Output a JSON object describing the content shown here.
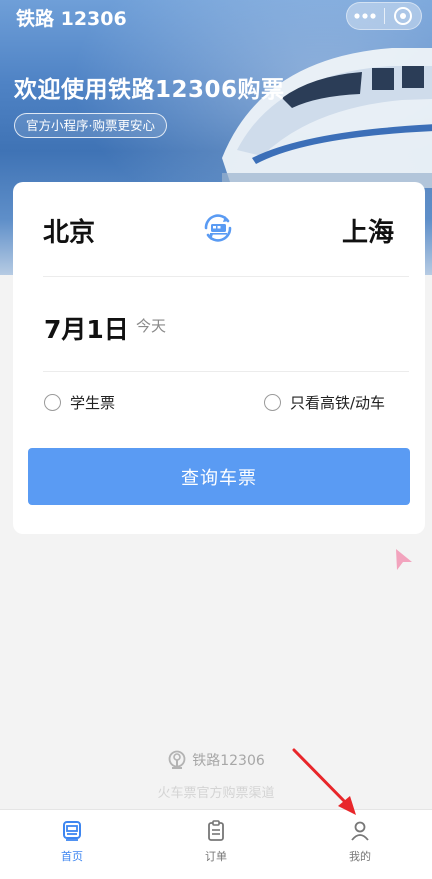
{
  "header": {
    "app_title": "铁路 12306",
    "more_icon": "more-dots-icon",
    "close_icon": "close-circle-icon"
  },
  "banner": {
    "welcome": "欢迎使用铁路12306购票",
    "slogan": "官方小程序·购票更安心"
  },
  "search": {
    "from_station": "北京",
    "to_station": "上海",
    "swap_icon": "swap-train-icon",
    "date": "7月1日",
    "date_hint": "今天",
    "student_ticket_label": "学生票",
    "high_speed_only_label": "只看高铁/动车",
    "query_button": "查询车票"
  },
  "brand": {
    "name": "铁路12306",
    "tagline": "火车票官方购票渠道"
  },
  "tabbar": {
    "items": [
      {
        "label": "首页",
        "icon": "train-home-icon",
        "active": true
      },
      {
        "label": "订单",
        "icon": "order-clipboard-icon",
        "active": false
      },
      {
        "label": "我的",
        "icon": "user-profile-icon",
        "active": false
      }
    ]
  },
  "colors": {
    "primary_button": "#5a9bf3",
    "active_tab": "#3e86f0",
    "annotation_arrow": "#e8262a"
  }
}
